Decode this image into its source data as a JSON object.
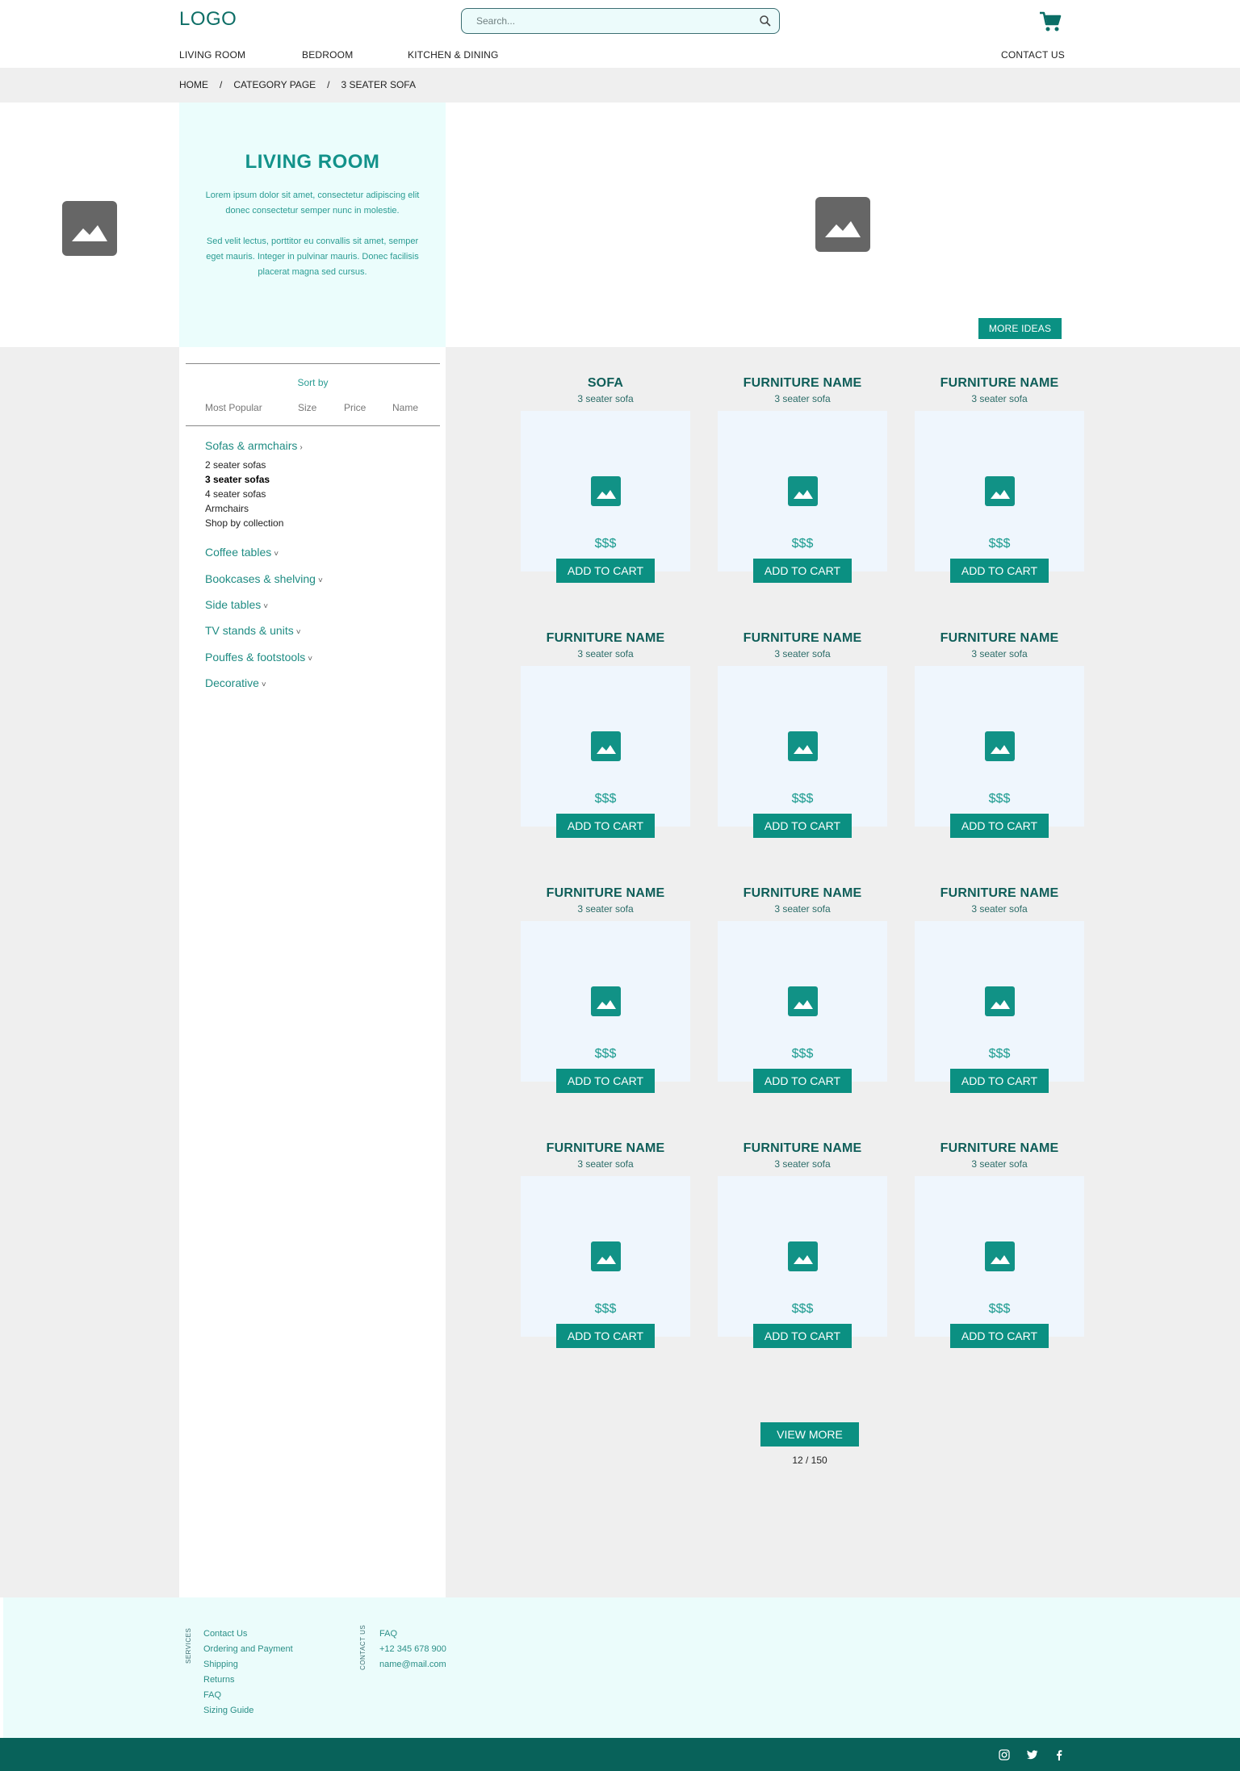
{
  "header": {
    "logo": "LOGO",
    "search_placeholder": "Search...",
    "nav": [
      "LIVING ROOM",
      "BEDROOM",
      "KITCHEN & DINING"
    ],
    "contact": "CONTACT US"
  },
  "breadcrumb": [
    "HOME",
    "/",
    "CATEGORY PAGE",
    "/",
    "3 SEATER SOFA"
  ],
  "intro": {
    "title": "LIVING ROOM",
    "p1": "Lorem ipsum dolor sit amet, consectetur adipiscing elit donec consectetur semper nunc in molestie.",
    "p2": "Sed velit lectus, porttitor eu convallis sit amet, semper eget mauris. Integer in pulvinar mauris. Donec facilisis placerat magna sed cursus."
  },
  "more_ideas": "MORE IDEAS",
  "sidebar": {
    "sort_by": "Sort by",
    "sort_options": [
      "Most Popular",
      "Size",
      "Price",
      "Name"
    ],
    "categories": [
      {
        "label": "Sofas & armchairs",
        "chev": "›"
      },
      {
        "label": "Coffee tables",
        "chev": "˅"
      },
      {
        "label": "Bookcases & shelving",
        "chev": "˅"
      },
      {
        "label": "Side tables",
        "chev": "˅"
      },
      {
        "label": "TV stands & units",
        "chev": "˅"
      },
      {
        "label": "Pouffes & footstools",
        "chev": "˅"
      },
      {
        "label": "Decorative",
        "chev": "˅"
      }
    ],
    "subcategories": [
      "2 seater sofas",
      "3 seater sofas",
      "4 seater sofas",
      "Armchairs",
      "Shop by collection"
    ],
    "active_sub": "3 seater sofas"
  },
  "products": [
    {
      "name": "SOFA",
      "sub": "3 seater sofa",
      "price": "$$$",
      "button": "ADD TO CART"
    },
    {
      "name": "FURNITURE NAME",
      "sub": "3 seater sofa",
      "price": "$$$",
      "button": "ADD TO CART"
    },
    {
      "name": "FURNITURE NAME",
      "sub": "3 seater sofa",
      "price": "$$$",
      "button": "ADD TO CART"
    },
    {
      "name": "FURNITURE NAME",
      "sub": "3 seater sofa",
      "price": "$$$",
      "button": "ADD TO CART"
    },
    {
      "name": "FURNITURE NAME",
      "sub": "3 seater sofa",
      "price": "$$$",
      "button": "ADD TO CART"
    },
    {
      "name": "FURNITURE NAME",
      "sub": "3 seater sofa",
      "price": "$$$",
      "button": "ADD TO CART"
    },
    {
      "name": "FURNITURE NAME",
      "sub": "3 seater sofa",
      "price": "$$$",
      "button": "ADD TO CART"
    },
    {
      "name": "FURNITURE NAME",
      "sub": "3 seater sofa",
      "price": "$$$",
      "button": "ADD TO CART"
    },
    {
      "name": "FURNITURE NAME",
      "sub": "3 seater sofa",
      "price": "$$$",
      "button": "ADD TO CART"
    },
    {
      "name": "FURNITURE NAME",
      "sub": "3 seater sofa",
      "price": "$$$",
      "button": "ADD TO CART"
    },
    {
      "name": "FURNITURE NAME",
      "sub": "3 seater sofa",
      "price": "$$$",
      "button": "ADD TO CART"
    },
    {
      "name": "FURNITURE NAME",
      "sub": "3 seater sofa",
      "price": "$$$",
      "button": "ADD TO CART"
    }
  ],
  "view_more": "VIEW MORE",
  "pagination": "12 / 150",
  "footer": {
    "services_label": "SERVICES",
    "services": [
      "Contact Us",
      "Ordering and Payment",
      "Shipping",
      "Returns",
      "FAQ",
      "Sizing Guide"
    ],
    "contact_label": "CONTACT US",
    "contact": [
      "FAQ",
      "+12 345 678 900",
      "name@mail.com"
    ]
  },
  "social_icons": [
    "instagram-icon",
    "twitter-icon",
    "facebook-icon"
  ]
}
